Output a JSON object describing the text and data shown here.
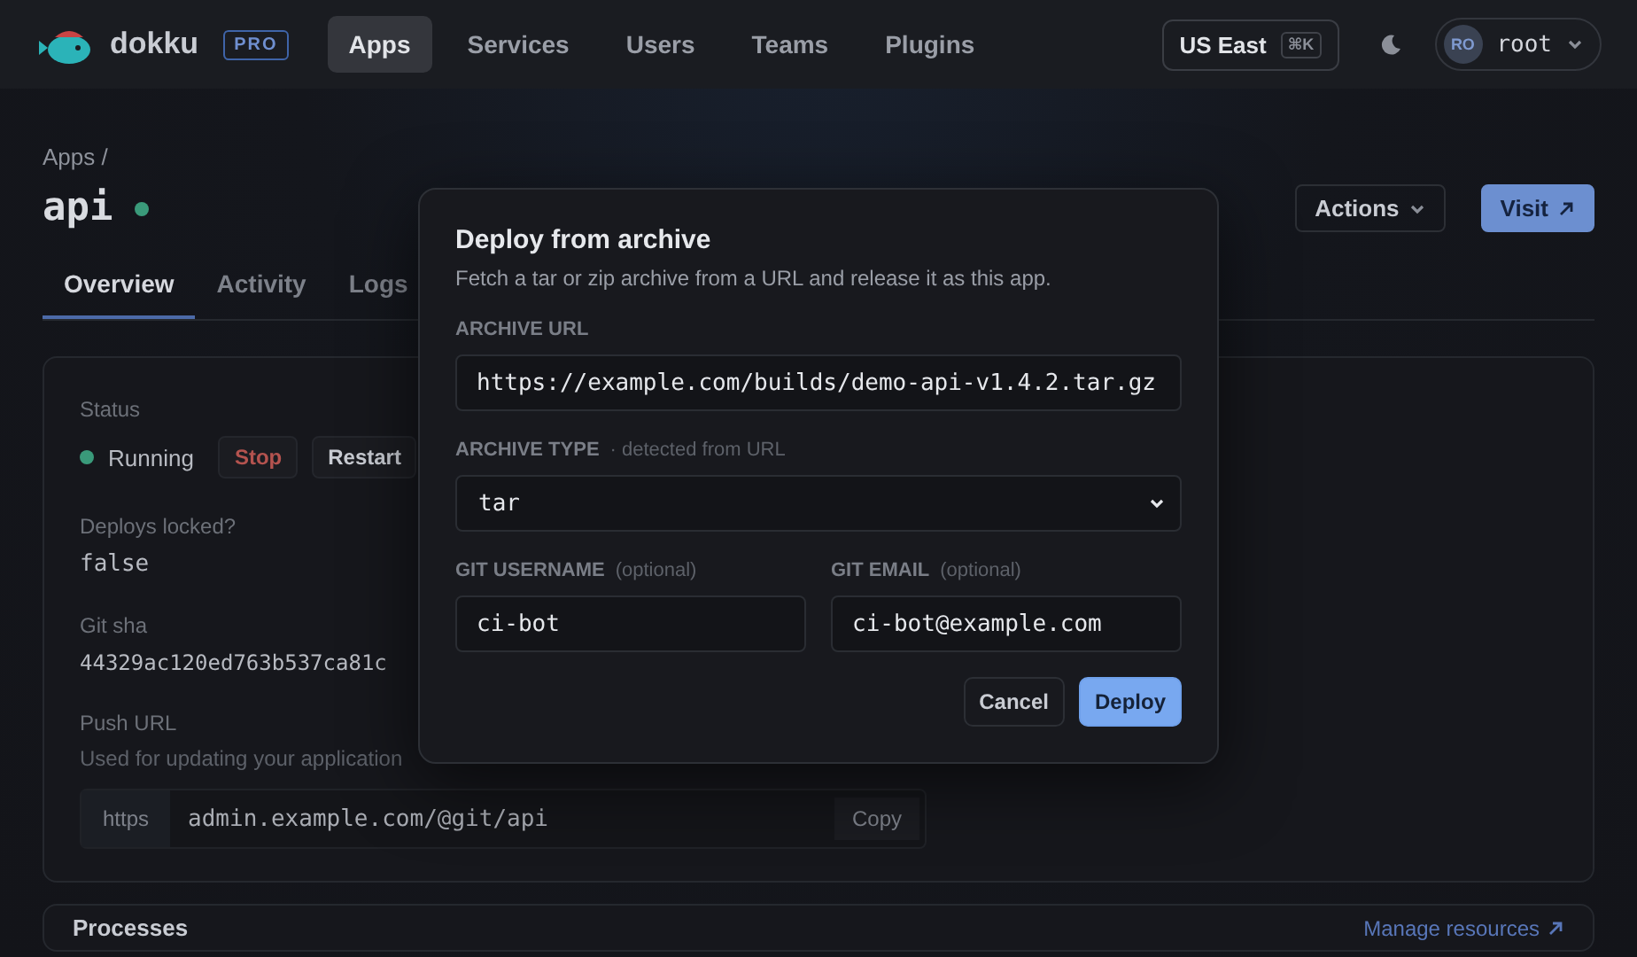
{
  "nav": {
    "brand": "dokku",
    "badge": "PRO",
    "items": [
      {
        "label": "Apps",
        "selected": true
      },
      {
        "label": "Services",
        "selected": false
      },
      {
        "label": "Users",
        "selected": false
      },
      {
        "label": "Teams",
        "selected": false
      },
      {
        "label": "Plugins",
        "selected": false
      }
    ],
    "region": {
      "label": "US East",
      "shortcut": "⌘K"
    },
    "user": {
      "initials": "RO",
      "name": "root"
    }
  },
  "breadcrumb": {
    "label": "Apps",
    "separator": "/"
  },
  "app": {
    "title": "api",
    "running": true
  },
  "header_buttons": [
    {
      "label": "Actions",
      "kind": "menu"
    },
    {
      "label": "Visit",
      "kind": "primary"
    }
  ],
  "tabs": [
    {
      "label": "Overview",
      "selected": true
    },
    {
      "label": "Activity",
      "selected": false
    },
    {
      "label": "Logs",
      "selected": false
    }
  ],
  "overview": {
    "status_label": "Status",
    "status": "Running",
    "running": true,
    "status_buttons": [
      {
        "label": "Stop",
        "kind": "danger"
      },
      {
        "label": "Restart",
        "kind": "plain"
      }
    ],
    "deploys_locked_label": "Deploys locked?",
    "deploys_locked": "false",
    "git_sha_label": "Git sha",
    "git_sha": "44329ac120ed763b537ca81c",
    "push_url_label": "Push URL",
    "push_url_hint": "Used for updating your application",
    "push_url": {
      "scheme": "https",
      "value": "admin.example.com/@git/api",
      "copy": "Copy"
    }
  },
  "processes": {
    "title": "Processes",
    "link": "Manage resources"
  },
  "dialog": {
    "title": "Deploy from archive",
    "description": "Fetch a tar or zip archive from a URL and release it as this app.",
    "url_label": "ARCHIVE URL",
    "url": "https://example.com/builds/demo-api-v1.4.2.tar.gz",
    "type_label": "ARCHIVE TYPE",
    "type_hint": "· detected from URL",
    "type": "tar",
    "username_label": "GIT USERNAME",
    "username_hint": "(optional)",
    "username": "ci-bot",
    "email_label": "GIT EMAIL",
    "email_hint": "(optional)",
    "email": "ci-bot@example.com",
    "buttons": [
      {
        "label": "Cancel",
        "kind": "plain"
      },
      {
        "label": "Deploy",
        "kind": "primary"
      }
    ]
  }
}
